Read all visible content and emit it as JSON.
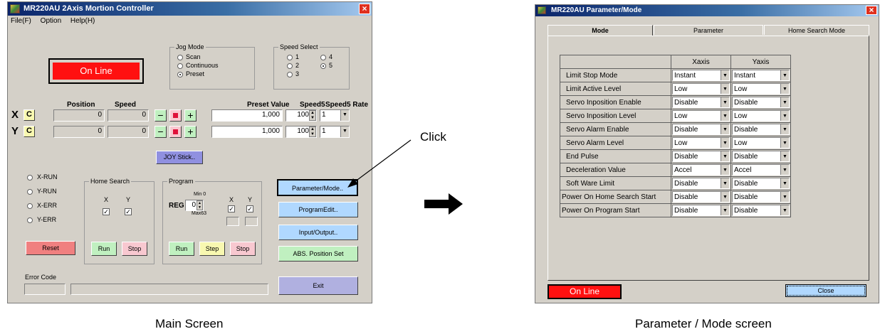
{
  "main": {
    "title": "MR220AU 2Axis Mortion Controller",
    "menu": [
      "File(F)",
      "Option",
      "Help(H)"
    ],
    "status": "On Line",
    "jog_mode": {
      "title": "Jog Mode",
      "options": [
        "Scan",
        "Continuous",
        "Preset"
      ],
      "selected": "Preset"
    },
    "speed_select": {
      "title": "Speed Select",
      "options": [
        "1",
        "4",
        "2",
        "5",
        "3"
      ],
      "selected": "5"
    },
    "headers": {
      "position": "Position",
      "speed": "Speed",
      "preset_value": "Preset Value",
      "speed5": "Speed5",
      "speed5_rate": "Speed5 Rate"
    },
    "axes": [
      {
        "label": "X",
        "clear": "C",
        "position": "0",
        "speed": "0",
        "preset": "1,000",
        "speed5": "100",
        "rate": "1"
      },
      {
        "label": "Y",
        "clear": "C",
        "position": "0",
        "speed": "0",
        "preset": "1,000",
        "speed5": "100",
        "rate": "1"
      }
    ],
    "jog_buttons": {
      "minus": "−",
      "plus": "+"
    },
    "joystick_button": "JOY Stick..",
    "indicators": [
      "X-RUN",
      "Y-RUN",
      "X-ERR",
      "Y-ERR"
    ],
    "home_search": {
      "title": "Home Search",
      "x": "X",
      "y": "Y",
      "run": "Run",
      "stop": "Stop"
    },
    "program": {
      "title": "Program",
      "reg": "REG",
      "reg_value": "0",
      "min": "Min 0",
      "max": "Max63",
      "x": "X",
      "y": "Y",
      "run": "Run",
      "step": "Step",
      "stop": "Stop"
    },
    "reset": "Reset",
    "buttons": [
      "Parameter/Mode..",
      "ProgramEdit..",
      "Input/Output..",
      "ABS. Position Set"
    ],
    "error_code_label": "Error Code",
    "exit": "Exit"
  },
  "arrow_label": "Click",
  "param": {
    "title": "MR220AU Parameter/Mode",
    "tabs": [
      "Mode",
      "Parameter",
      "Home Search Mode"
    ],
    "active_tab": "Mode",
    "col_headers": [
      "Xaxis",
      "Yaxis"
    ],
    "rows": [
      {
        "label": "Limit Stop Mode",
        "x": "Instant",
        "y": "Instant"
      },
      {
        "label": "Limit Active Level",
        "x": "Low",
        "y": "Low"
      },
      {
        "label": "Servo Inposition Enable",
        "x": "Disable",
        "y": "Disable"
      },
      {
        "label": "Servo Inposition Level",
        "x": "Low",
        "y": "Low"
      },
      {
        "label": "Servo Alarm Enable",
        "x": "Disable",
        "y": "Disable"
      },
      {
        "label": "Servo Alarm Level",
        "x": "Low",
        "y": "Low"
      },
      {
        "label": "End Pulse",
        "x": "Disable",
        "y": "Disable"
      },
      {
        "label": "Deceleration Value",
        "x": "Accel",
        "y": "Accel"
      },
      {
        "label": "Soft Ware Limit",
        "x": "Disable",
        "y": "Disable"
      },
      {
        "label": "Power On Home Search Start",
        "x": "Disable",
        "y": "Disable"
      },
      {
        "label": "Power On Program Start",
        "x": "Disable",
        "y": "Disable"
      }
    ],
    "status": "On Line",
    "close": "Close"
  },
  "captions": {
    "main": "Main Screen",
    "param": "Parameter / Mode screen"
  },
  "colors": {
    "online": "#ff1010",
    "reset": "#f08080",
    "run": "#c0f0c0",
    "stop": "#f8c8d0",
    "step": "#f8f8b0",
    "joystick": "#9090e0",
    "param_btn": "#b0d8ff",
    "exit": "#b0b0e0"
  }
}
